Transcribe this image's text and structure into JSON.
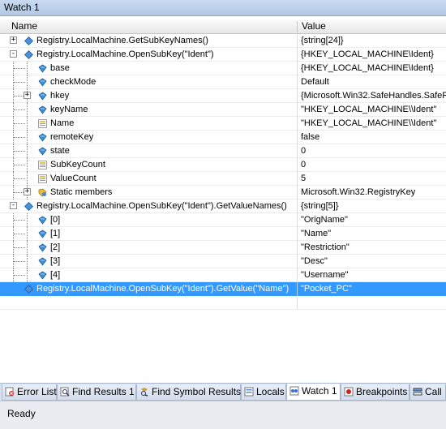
{
  "window": {
    "title": "Watch 1"
  },
  "columns": {
    "name": "Name",
    "value": "Value"
  },
  "rows": [
    {
      "name": "Registry.LocalMachine.GetSubKeyNames()",
      "value": "{string[24]}",
      "level": 0,
      "expander": "+",
      "icon": "method-icon"
    },
    {
      "name": "Registry.LocalMachine.OpenSubKey(\"Ident\")",
      "value": "{HKEY_LOCAL_MACHINE\\Ident}",
      "level": 0,
      "expander": "-",
      "icon": "method-icon"
    },
    {
      "name": "base",
      "value": "{HKEY_LOCAL_MACHINE\\Ident}",
      "level": 1,
      "expander": "",
      "icon": "field-icon"
    },
    {
      "name": "checkMode",
      "value": "Default",
      "level": 1,
      "expander": "",
      "icon": "field-icon"
    },
    {
      "name": "hkey",
      "value": "{Microsoft.Win32.SafeHandles.SafeR",
      "level": 1,
      "expander": "+",
      "icon": "field-icon"
    },
    {
      "name": "keyName",
      "value": "\"HKEY_LOCAL_MACHINE\\\\Ident\"",
      "level": 1,
      "expander": "",
      "icon": "field-icon"
    },
    {
      "name": "Name",
      "value": "\"HKEY_LOCAL_MACHINE\\\\Ident\"",
      "level": 1,
      "expander": "",
      "icon": "property-icon"
    },
    {
      "name": "remoteKey",
      "value": "false",
      "level": 1,
      "expander": "",
      "icon": "field-icon"
    },
    {
      "name": "state",
      "value": "0",
      "level": 1,
      "expander": "",
      "icon": "field-icon"
    },
    {
      "name": "SubKeyCount",
      "value": "0",
      "level": 1,
      "expander": "",
      "icon": "property-icon"
    },
    {
      "name": "ValueCount",
      "value": "5",
      "level": 1,
      "expander": "",
      "icon": "property-icon"
    },
    {
      "name": "Static members",
      "value": "Microsoft.Win32.RegistryKey",
      "level": 1,
      "expander": "+",
      "icon": "static-members-icon"
    },
    {
      "name": "Registry.LocalMachine.OpenSubKey(\"Ident\").GetValueNames()",
      "value": "{string[5]}",
      "level": 0,
      "expander": "-",
      "icon": "method-icon"
    },
    {
      "name": "[0]",
      "value": "\"OrigName\"",
      "level": 1,
      "expander": "",
      "icon": "field-icon"
    },
    {
      "name": "[1]",
      "value": "\"Name\"",
      "level": 1,
      "expander": "",
      "icon": "field-icon"
    },
    {
      "name": "[2]",
      "value": "\"Restriction\"",
      "level": 1,
      "expander": "",
      "icon": "field-icon"
    },
    {
      "name": "[3]",
      "value": "\"Desc\"",
      "level": 1,
      "expander": "",
      "icon": "field-icon"
    },
    {
      "name": "[4]",
      "value": "\"Username\"",
      "level": 1,
      "expander": "",
      "icon": "field-icon"
    },
    {
      "name": "Registry.LocalMachine.OpenSubKey(\"Ident\").GetValue(\"Name\")",
      "value": "\"Pocket_PC\"",
      "level": 0,
      "expander": "",
      "icon": "method-icon",
      "selected": true
    },
    {
      "name": "",
      "value": "",
      "level": 0,
      "expander": "",
      "icon": ""
    }
  ],
  "tabs": [
    {
      "label": "Error List",
      "icon": "error-list-icon",
      "active": false
    },
    {
      "label": "Find Results 1",
      "icon": "find-results-icon",
      "active": false
    },
    {
      "label": "Find Symbol Results",
      "icon": "find-symbol-icon",
      "active": false
    },
    {
      "label": "Locals",
      "icon": "locals-icon",
      "active": false
    },
    {
      "label": "Watch 1",
      "icon": "watch-icon",
      "active": true
    },
    {
      "label": "Breakpoints",
      "icon": "breakpoints-icon",
      "active": false
    },
    {
      "label": "Call",
      "icon": "call-stack-icon",
      "active": false
    }
  ],
  "status": {
    "text": "Ready"
  },
  "colors": {
    "selection": "#3399ff",
    "tab_strip": "#d8e1ef",
    "title_bar": "#c9daf0"
  }
}
